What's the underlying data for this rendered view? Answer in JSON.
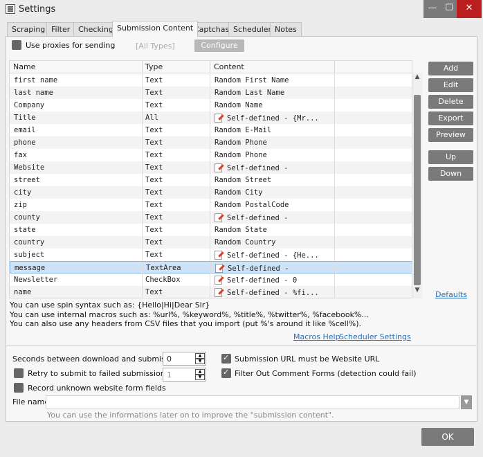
{
  "window": {
    "title": "Settings",
    "minimize": "—",
    "maximize": "☐",
    "close": "✕"
  },
  "tabs": [
    "Scraping",
    "Filter",
    "Checking",
    "Submission Content",
    "Captchas",
    "Scheduler",
    "Notes"
  ],
  "active_tab": "Submission Content",
  "proxy": {
    "label": "Use proxies for sending",
    "checked": false,
    "types": "[All Types]",
    "configure": "Configure"
  },
  "table": {
    "columns": [
      "Name",
      "Type",
      "Content"
    ],
    "rows": [
      {
        "name": "first name",
        "type": "Text",
        "content": "Random First Name",
        "edit": false
      },
      {
        "name": "last name",
        "type": "Text",
        "content": "Random Last Name",
        "edit": false
      },
      {
        "name": "Company",
        "type": "Text",
        "content": "Random Name",
        "edit": false
      },
      {
        "name": "Title",
        "type": "All",
        "content": "Self-defined - {Mr...",
        "edit": true
      },
      {
        "name": "email",
        "type": "Text",
        "content": "Random E-Mail",
        "edit": false
      },
      {
        "name": "phone",
        "type": "Text",
        "content": "Random Phone",
        "edit": false
      },
      {
        "name": "fax",
        "type": "Text",
        "content": "Random Phone",
        "edit": false
      },
      {
        "name": "Website",
        "type": "Text",
        "content": "Self-defined -",
        "edit": true
      },
      {
        "name": "street",
        "type": "Text",
        "content": "Random Street",
        "edit": false
      },
      {
        "name": "city",
        "type": "Text",
        "content": "Random City",
        "edit": false
      },
      {
        "name": "zip",
        "type": "Text",
        "content": "Random PostalCode",
        "edit": false
      },
      {
        "name": "county",
        "type": "Text",
        "content": "Self-defined -",
        "edit": true
      },
      {
        "name": "state",
        "type": "Text",
        "content": "Random State",
        "edit": false
      },
      {
        "name": "country",
        "type": "Text",
        "content": "Random Country",
        "edit": false
      },
      {
        "name": "subject",
        "type": "Text",
        "content": "Self-defined - {He...",
        "edit": true
      },
      {
        "name": "message",
        "type": "TextArea",
        "content": "Self-defined -",
        "edit": true,
        "selected": true
      },
      {
        "name": "Newsletter",
        "type": "CheckBox",
        "content": "Self-defined - 0",
        "edit": true
      },
      {
        "name": "name",
        "type": "Text",
        "content": "Self-defined - %fi...",
        "edit": true
      }
    ]
  },
  "side_buttons": {
    "add": "Add",
    "edit": "Edit",
    "delete": "Delete",
    "export": "Export",
    "preview": "Preview",
    "up": "Up",
    "down": "Down"
  },
  "defaults_link": "Defaults",
  "help_lines": [
    "You can use spin syntax such as: {Hello|Hi|Dear Sir}",
    "You can use internal macros such as: %url%, %keyword%, %title%, %twitter%, %facebook%...",
    "You can also use any headers from CSV files that you import (put %'s around it like %cell%)."
  ],
  "macros_help": "Macros Help",
  "scheduler_settings": "Scheduler Settings",
  "options": {
    "seconds_label": "Seconds between download and submission",
    "seconds_value": "0",
    "retry_label": "Retry to submit to failed submissions",
    "retry_value": "1",
    "retry_checked": false,
    "record_label": "Record unknown website form fields",
    "record_checked": false,
    "url_must_label": "Submission URL must be Website URL",
    "url_must_checked": true,
    "filter_comment_label": "Filter Out Comment Forms (detection could fail)",
    "filter_comment_checked": true
  },
  "file_name": {
    "label": "File name",
    "value": "",
    "hint": "You can use the informations later on to improve the \"submission content\"."
  },
  "ok": "OK",
  "colors": {
    "button_bg": "#7a7a7a",
    "close_bg": "#bb1e1e",
    "link": "#2a6fb3",
    "selected_row": "#cfe3f8"
  }
}
